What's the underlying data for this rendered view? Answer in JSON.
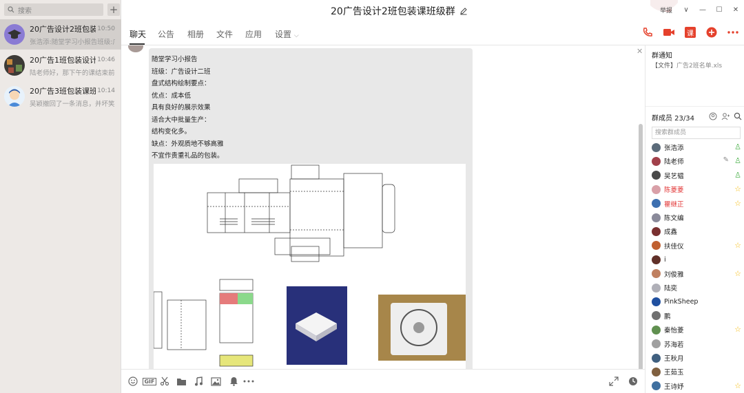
{
  "left_pane": {
    "search_placeholder": "搜索",
    "add_label": "+",
    "conversations": [
      {
        "name": "20广告设计2班包装",
        "time": "10:50",
        "preview": "张浩添:随堂学习小报告班级:广",
        "active": true
      },
      {
        "name": "20广告1班包装设计",
        "time": "10:46",
        "preview": "陆老师好，那下午的课结束前把",
        "active": false
      },
      {
        "name": "20广告3班包装课班",
        "time": "10:14",
        "preview": "吴颖撤回了一条消息，并坏笑了",
        "active": false
      }
    ]
  },
  "titlebar": {
    "title": "20广告设计2班包装课班级群",
    "report": "举报",
    "controls": [
      "∨",
      "—",
      "☐",
      "✕"
    ]
  },
  "tabs": [
    {
      "label": "聊天",
      "active": true
    },
    {
      "label": "公告",
      "active": false
    },
    {
      "label": "相册",
      "active": false
    },
    {
      "label": "文件",
      "active": false
    },
    {
      "label": "应用",
      "active": false
    },
    {
      "label": "设置",
      "active": false
    }
  ],
  "header_icons": [
    "phone-icon",
    "video-icon",
    "class-icon",
    "add-icon",
    "more-icon"
  ],
  "header_class_label": "课",
  "message": {
    "lines": [
      "随堂学习小报告",
      "班级：广告设计二班",
      "盘式结构绘制要点：",
      "优点：成本低",
      "具有良好的展示效果",
      "适合大中批量生产：",
      "结构变化多。",
      "缺点：外观质地不够高雅",
      "不宜作贵重礼品的包装。"
    ]
  },
  "toolbar": {
    "gif_label": "GIF",
    "left_tools": [
      "emoji-icon",
      "gif-icon",
      "scissors-icon",
      "folder-icon",
      "music-icon",
      "image-icon",
      "bell-icon",
      "more-icon"
    ],
    "right_tools": [
      "expand-icon",
      "history-icon"
    ]
  },
  "right_panel": {
    "notice_title": "群通知",
    "notice_tag": "【文件】",
    "notice_file": "广告2班名单.xls",
    "members_title": "群成员 23/34",
    "member_search_placeholder": "搜索群成员",
    "members": [
      {
        "name": "张浩添",
        "red": false,
        "badge": "admin"
      },
      {
        "name": "陆老师",
        "red": false,
        "badge": "admin",
        "editable": true
      },
      {
        "name": "吴艺韫",
        "red": false,
        "badge": "admin"
      },
      {
        "name": "陈菱菱",
        "red": true,
        "badge": "star"
      },
      {
        "name": "瞿继正",
        "red": true,
        "badge": "star"
      },
      {
        "name": "陈文编",
        "red": false,
        "badge": ""
      },
      {
        "name": "成鑫",
        "red": false,
        "badge": ""
      },
      {
        "name": "扶佳仪",
        "red": false,
        "badge": "star"
      },
      {
        "name": "i",
        "red": false,
        "badge": ""
      },
      {
        "name": "刘俊雅",
        "red": false,
        "badge": "star"
      },
      {
        "name": "陆奕",
        "red": false,
        "badge": ""
      },
      {
        "name": "PinkSheep",
        "red": false,
        "badge": ""
      },
      {
        "name": "鹏",
        "red": false,
        "badge": ""
      },
      {
        "name": "秦怡菱",
        "red": false,
        "badge": "star"
      },
      {
        "name": "苏海若",
        "red": false,
        "badge": ""
      },
      {
        "name": "王秋月",
        "red": false,
        "badge": ""
      },
      {
        "name": "王茹玉",
        "red": false,
        "badge": ""
      },
      {
        "name": "王诗妤",
        "red": false,
        "badge": "star"
      }
    ]
  },
  "colors": {
    "left_bg": "#ede9e6",
    "active_conv": "#d3cfcc",
    "accent_red": "#e23636",
    "bubble": "#e8e8e8",
    "star": "#f5b800"
  }
}
